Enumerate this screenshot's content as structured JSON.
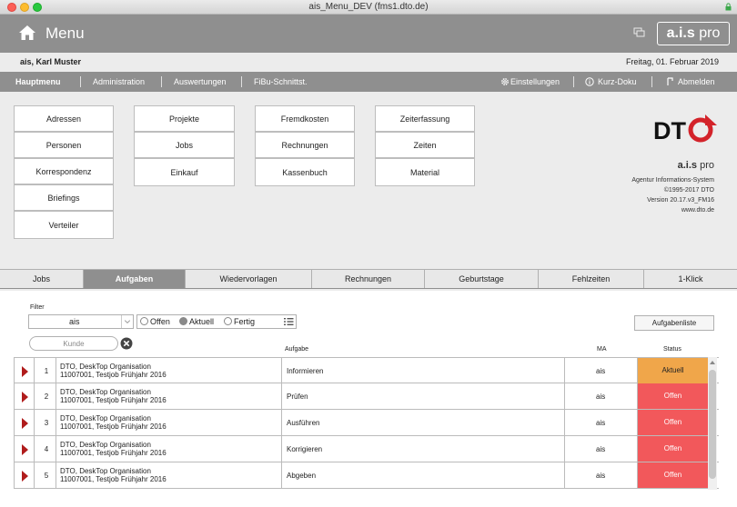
{
  "window": {
    "title": "ais_Menu_DEV (fms1.dto.de)"
  },
  "header": {
    "title": "Menu",
    "logo_text_bold": "a.i.s",
    "logo_text": " pro"
  },
  "userbar": {
    "user": "ais, Karl Muster",
    "date": "Freitag, 01. Februar 2019"
  },
  "nav": {
    "left": [
      "Hauptmenu",
      "Administration",
      "Auswertungen",
      "FiBu-Schnittst."
    ],
    "einstellungen": "Einstellungen",
    "kurz_doku": "Kurz-Doku",
    "abmelden": "Abmelden"
  },
  "main_buttons": {
    "col1": [
      "Adressen",
      "Personen",
      "Korrespondenz",
      "Briefings",
      "Verteiler"
    ],
    "col2": [
      "Projekte",
      "Jobs",
      "Einkauf"
    ],
    "col3": [
      "Fremdkosten",
      "Rechnungen",
      "Kassenbuch"
    ],
    "col4": [
      "Zeiterfassung",
      "Zeiten",
      "Material"
    ]
  },
  "info": {
    "ais_bold": "a.i.s",
    "ais_rest": " pro",
    "lines": [
      "Agentur Informations-System",
      "©1995-2017 DTO",
      "Version 20.17.v3_FM16",
      "www.dto.de"
    ]
  },
  "tabs": [
    "Jobs",
    "Aufgaben",
    "Wiedervorlagen",
    "Rechnungen",
    "Geburtstage",
    "Fehlzeiten",
    "1-Klick"
  ],
  "filter": {
    "label": "Filter",
    "value": "ais",
    "radios": [
      "Offen",
      "Aktuell",
      "Fertig"
    ],
    "kunde_placeholder": "Kunde",
    "aufgabenliste": "Aufgabenliste"
  },
  "table": {
    "headers": {
      "task": "Aufgabe",
      "ma": "MA",
      "status": "Status"
    },
    "rows": [
      {
        "num": "1",
        "client": "DTO, DeskTop Organisation",
        "job": "11007001, Testjob Frühjahr 2016",
        "task": "Informieren",
        "ma": "ais",
        "status": "Aktuell"
      },
      {
        "num": "2",
        "client": "DTO, DeskTop Organisation",
        "job": "11007001, Testjob Frühjahr 2016",
        "task": "Prüfen",
        "ma": "ais",
        "status": "Offen"
      },
      {
        "num": "3",
        "client": "DTO, DeskTop Organisation",
        "job": "11007001, Testjob Frühjahr 2016",
        "task": "Ausführen",
        "ma": "ais",
        "status": "Offen"
      },
      {
        "num": "4",
        "client": "DTO, DeskTop Organisation",
        "job": "11007001, Testjob Frühjahr 2016",
        "task": "Korrigieren",
        "ma": "ais",
        "status": "Offen"
      },
      {
        "num": "5",
        "client": "DTO, DeskTop Organisation",
        "job": "11007001, Testjob Frühjahr 2016",
        "task": "Abgeben",
        "ma": "ais",
        "status": "Offen"
      }
    ]
  },
  "colors": {
    "aktuell": "#f0a64a",
    "offen": "#f2585b",
    "header": "#8f8f8f",
    "accent": "#b01c1c"
  }
}
